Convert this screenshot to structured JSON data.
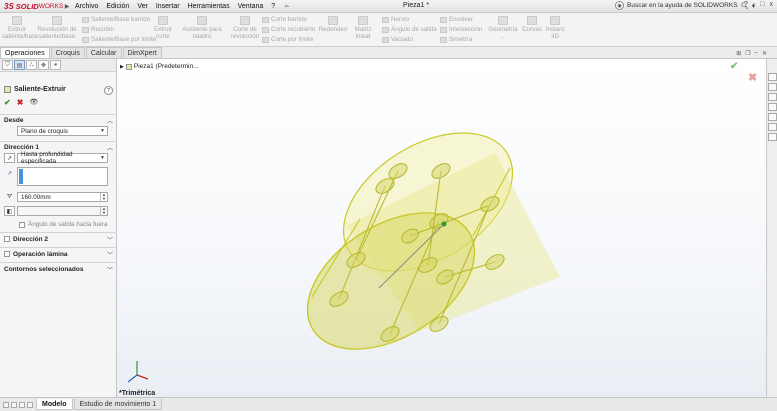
{
  "app": {
    "brand_prefix": "3S",
    "brand_main": "SOLID",
    "brand_suffix": "WORKS",
    "document_title": "Pieza1 *",
    "menu": [
      "Archivo",
      "Edición",
      "Ver",
      "Insertar",
      "Herramientas",
      "Ventana",
      "?"
    ],
    "pin_glyph": "⇔",
    "help_search_placeholder": "Buscar en la ayuda de SOLIDWORKS",
    "right_controls": [
      "?",
      "-",
      "□",
      "x"
    ]
  },
  "ribbon": {
    "big_buttons": [
      {
        "label": "Extruir saliente/base",
        "icon": "extrude-boss-icon"
      },
      {
        "label": "Revolución de saliente/base",
        "icon": "revolve-boss-icon"
      },
      {
        "label": "Extruir corte",
        "icon": "extrude-cut-icon"
      },
      {
        "label": "Asistente para taladro",
        "icon": "hole-wizard-icon"
      },
      {
        "label": "Corte de revolución",
        "icon": "revolve-cut-icon"
      },
      {
        "label": "Redondeo",
        "icon": "fillet-icon"
      },
      {
        "label": "Matriz lineal",
        "icon": "linear-pattern-icon"
      },
      {
        "label": "Geometría ...",
        "icon": "ref-geometry-icon"
      },
      {
        "label": "Curvas",
        "icon": "curves-icon"
      },
      {
        "label": "Instant 3D",
        "icon": "instant3d-icon"
      }
    ],
    "small_buttons": [
      {
        "label": "Saliente/Base barrido",
        "icon": "swept-boss-icon"
      },
      {
        "label": "Recubrir",
        "icon": "loft-icon"
      },
      {
        "label": "Saliente/Base por límite",
        "icon": "boundary-boss-icon"
      },
      {
        "label": "Corte barrido",
        "icon": "swept-cut-icon"
      },
      {
        "label": "Corte recubierto",
        "icon": "lofted-cut-icon"
      },
      {
        "label": "Corte por límite",
        "icon": "boundary-cut-icon"
      },
      {
        "label": "Nervio",
        "icon": "rib-icon"
      },
      {
        "label": "Ángulo de salida",
        "icon": "draft-icon"
      },
      {
        "label": "Vaciado",
        "icon": "shell-icon"
      },
      {
        "label": "Envolver",
        "icon": "wrap-icon"
      },
      {
        "label": "Intersección",
        "icon": "intersect-icon"
      },
      {
        "label": "Simetría",
        "icon": "mirror-icon"
      }
    ]
  },
  "tabs": [
    "Operaciones",
    "Croquis",
    "Calcular",
    "DimXpert"
  ],
  "property_manager": {
    "title": "Saliente-Extruir",
    "help_glyph": "?",
    "ok_glyph": "✔",
    "cancel_glyph": "✖",
    "desde_label": "Desde",
    "desde_value": "Plano de croquis",
    "direccion1_label": "Dirección 1",
    "end_condition": "Hasta profundidad especificada",
    "depth_value": "160.00mm",
    "draft_checkbox_label": "Ángulo de salida hacia fuera",
    "direccion2_label": "Dirección 2",
    "operacion_lamina_label": "Operación lámina",
    "contornos_label": "Contornos seleccionados"
  },
  "viewport": {
    "tree_label": "Pieza1  (Predetermin...",
    "view_name": "*Trimétrica",
    "model_color": "#e8e88a",
    "edge_color": "#c9c929"
  },
  "bottom_tabs": [
    "Modelo",
    "Estudio de movimiento 1"
  ]
}
